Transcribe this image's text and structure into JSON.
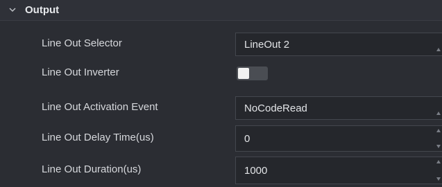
{
  "section": {
    "title": "Output"
  },
  "rows": [
    {
      "label": "Line Out Selector",
      "control": "select",
      "value": "LineOut 2"
    },
    {
      "label": "Line Out Inverter",
      "control": "toggle",
      "value": "off"
    },
    {
      "label": "Line Out Activation Event",
      "control": "select",
      "value": "NoCodeRead"
    },
    {
      "label": "Line Out Delay Time(us)",
      "control": "spinbox",
      "value": "0"
    },
    {
      "label": "Line Out Duration(us)",
      "control": "spinbox",
      "value": "1000"
    }
  ],
  "colors": {
    "background": "#2b2d33",
    "field": "#25272c",
    "text": "#d6d8dc"
  }
}
